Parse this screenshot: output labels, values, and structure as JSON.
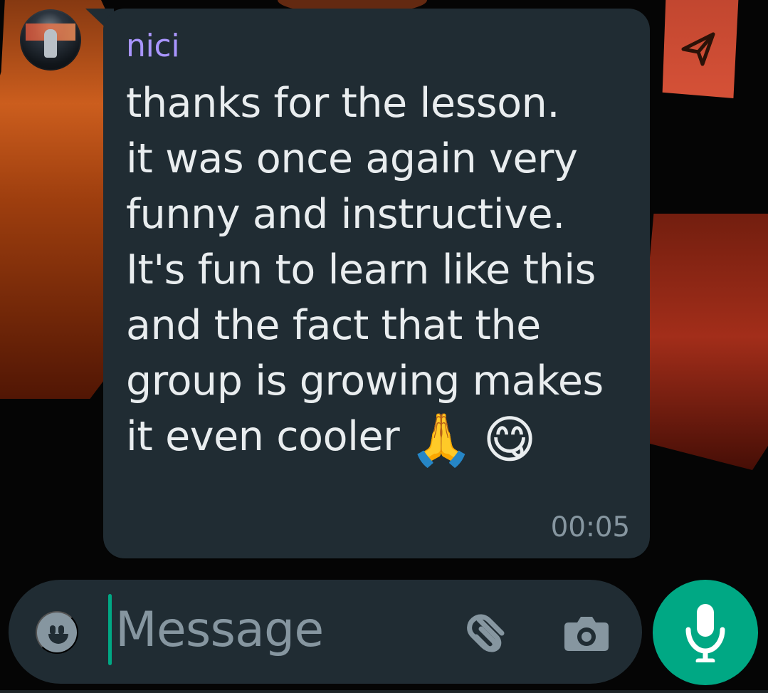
{
  "chat": {
    "sender_name": "nici",
    "message_lines": [
      "thanks for the lesson.",
      "it was once again very",
      "funny and instructive.",
      "It's fun to learn like this",
      "and the fact that the",
      "group is growing makes",
      "it even cooler"
    ],
    "emojis": [
      "🙏",
      "😋"
    ],
    "timestamp": "00:05"
  },
  "composer": {
    "placeholder": "Message",
    "value": ""
  },
  "icons": {
    "send": "send-arrow-icon",
    "emoji": "emoji-icon",
    "attach": "paperclip-icon",
    "camera": "camera-icon",
    "mic": "microphone-icon"
  },
  "colors": {
    "bubble": "#202c33",
    "sender": "#a995ff",
    "text": "#e9edef",
    "muted": "#8696a0",
    "accent": "#00a884"
  }
}
